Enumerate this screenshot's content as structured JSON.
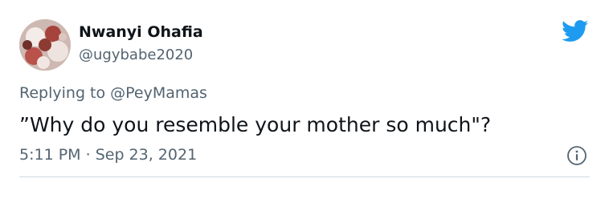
{
  "author": {
    "display_name": "Nwanyi Ohafia",
    "handle": "@ugybabe2020",
    "avatar_icon": "user-avatar"
  },
  "tweet": {
    "replying_to": "Replying to @PeyMamas",
    "text": "”Why do you resemble your mother so much\"?",
    "time": "5:11 PM",
    "separator": "·",
    "date": "Sep 23, 2021"
  },
  "icons": {
    "brand": "twitter-bird-icon",
    "info": "info-icon"
  },
  "colors": {
    "brand_blue": "#1d9bf0",
    "text_primary": "#0f1419",
    "text_secondary": "#536471",
    "divider": "#cfd9de"
  }
}
